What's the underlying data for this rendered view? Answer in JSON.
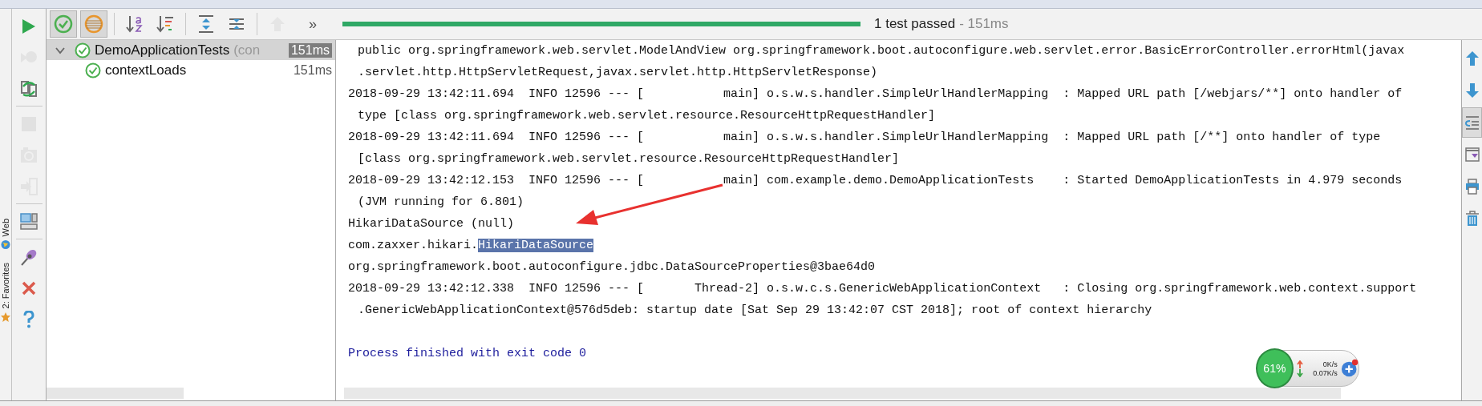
{
  "side_tabs": [
    {
      "label": "Web",
      "kind": "globe"
    },
    {
      "label": "2: Favorites",
      "kind": "star"
    }
  ],
  "run_toolbar": [
    {
      "kind": "run",
      "disabled": false
    },
    {
      "kind": "rerun-failed",
      "disabled": true
    },
    {
      "kind": "toggle-auto",
      "disabled": false
    },
    {
      "kind": "stop",
      "disabled": true
    },
    {
      "kind": "camera",
      "disabled": true
    },
    {
      "kind": "import",
      "disabled": true
    },
    {
      "kind": "layout",
      "disabled": false
    },
    {
      "kind": "pin",
      "disabled": false
    },
    {
      "kind": "close",
      "disabled": false
    },
    {
      "kind": "help",
      "disabled": false
    }
  ],
  "test_toolbar": {
    "buttons": [
      {
        "kind": "show-passed",
        "pressed": true,
        "disabled": false
      },
      {
        "kind": "show-ignored",
        "pressed": true,
        "disabled": false
      },
      {
        "kind": "sort-alpha",
        "pressed": false,
        "disabled": false
      },
      {
        "kind": "sort-duration",
        "pressed": false,
        "disabled": false
      },
      {
        "kind": "expand-all",
        "pressed": false,
        "disabled": false
      },
      {
        "kind": "collapse-all",
        "pressed": false,
        "disabled": false
      },
      {
        "kind": "previous",
        "pressed": false,
        "disabled": true
      }
    ],
    "more": "»"
  },
  "progress": {
    "level": 1,
    "status": "1 test passed",
    "duration": "- 151ms"
  },
  "tests": [
    {
      "name": "DemoApplicationTests",
      "detail": "(con",
      "time": "151ms",
      "kind": "passed",
      "expanded": true,
      "selected": true,
      "children": [
        {
          "name": "contextLoads",
          "time": "151ms",
          "kind": "passed",
          "selected": false
        }
      ]
    }
  ],
  "console": [
    {
      "kind": "wrap",
      "text": "public org.springframework.web.servlet.ModelAndView org.springframework.boot.autoconfigure.web.servlet.error.BasicErrorController.errorHtml(javax"
    },
    {
      "kind": "wrap",
      "text": ".servlet.http.HttpServletRequest,javax.servlet.http.HttpServletResponse)"
    },
    {
      "kind": "log",
      "text": "2018-09-29 13:42:11.694  INFO 12596 --- [           main] o.s.w.s.handler.SimpleUrlHandlerMapping  : Mapped URL path [/webjars/**] onto handler of"
    },
    {
      "kind": "wrap",
      "text": "type [class org.springframework.web.servlet.resource.ResourceHttpRequestHandler]"
    },
    {
      "kind": "log",
      "text": "2018-09-29 13:42:11.694  INFO 12596 --- [           main] o.s.w.s.handler.SimpleUrlHandlerMapping  : Mapped URL path [/**] onto handler of type"
    },
    {
      "kind": "wrap",
      "text": "[class org.springframework.web.servlet.resource.ResourceHttpRequestHandler]"
    },
    {
      "kind": "log",
      "text": "2018-09-29 13:42:12.153  INFO 12596 --- [           main] com.example.demo.DemoApplicationTests    : Started DemoApplicationTests in 4.979 seconds"
    },
    {
      "kind": "wrap",
      "text": "(JVM running for 6.801)"
    },
    {
      "kind": "log",
      "text": "HikariDataSource (null)"
    },
    {
      "kind": "log",
      "text": "com.zaxxer.hikari.",
      "selected_text": "HikariDataSource"
    },
    {
      "kind": "log",
      "text": "org.springframework.boot.autoconfigure.jdbc.DataSourceProperties@3bae64d0"
    },
    {
      "kind": "log",
      "text": "2018-09-29 13:42:12.338  INFO 12596 --- [       Thread-2] o.s.w.c.s.GenericWebApplicationContext   : Closing org.springframework.web.context.support"
    },
    {
      "kind": "wrap",
      "text": ".GenericWebApplicationContext@576d5deb: startup date [Sat Sep 29 13:42:07 CST 2018]; root of context hierarchy"
    },
    {
      "kind": "exit",
      "text": "Process finished with exit code 0"
    }
  ],
  "right_toolbar": [
    {
      "kind": "up",
      "pressed": false
    },
    {
      "kind": "down",
      "pressed": false
    },
    {
      "kind": "soft-wrap",
      "pressed": true
    },
    {
      "kind": "scroll-end",
      "pressed": false
    },
    {
      "kind": "print",
      "pressed": false
    },
    {
      "kind": "clear",
      "pressed": false
    }
  ],
  "net_widget": {
    "cpu": "61%",
    "upload": "0K/s",
    "download": "0.07K/s"
  }
}
